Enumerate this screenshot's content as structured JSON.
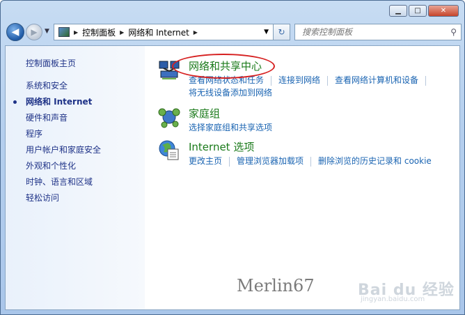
{
  "window": {
    "minimize_glyph": "▁",
    "maximize_glyph": "□",
    "close_glyph": "✕"
  },
  "nav": {
    "breadcrumb": [
      "控制面板",
      "网络和 Internet"
    ],
    "search_placeholder": "搜索控制面板"
  },
  "sidebar": {
    "home": "控制面板主页",
    "items": [
      {
        "label": "系统和安全"
      },
      {
        "label": "网络和 Internet",
        "active": true
      },
      {
        "label": "硬件和声音"
      },
      {
        "label": "程序"
      },
      {
        "label": "用户帐户和家庭安全"
      },
      {
        "label": "外观和个性化"
      },
      {
        "label": "时钟、语言和区域"
      },
      {
        "label": "轻松访问"
      }
    ]
  },
  "categories": [
    {
      "title": "网络和共享中心",
      "icon": "network-sharing-icon",
      "links": [
        "查看网络状态和任务",
        "连接到网络",
        "查看网络计算机和设备"
      ],
      "links_row2": [
        "将无线设备添加到网络"
      ]
    },
    {
      "title": "家庭组",
      "icon": "homegroup-icon",
      "links": [
        "选择家庭组和共享选项"
      ]
    },
    {
      "title": "Internet 选项",
      "icon": "internet-options-icon",
      "links": [
        "更改主页",
        "管理浏览器加载项",
        "删除浏览的历史记录和 cookie"
      ]
    }
  ],
  "watermark": {
    "author": "Merlin67",
    "brand": "Bai du 经验",
    "url": "jingyan.baidu.com"
  },
  "colors": {
    "link": "#1a64b2",
    "category_title": "#1a7a1a",
    "sidebar_text": "#1e3287",
    "highlight_ellipse": "#d62020"
  }
}
